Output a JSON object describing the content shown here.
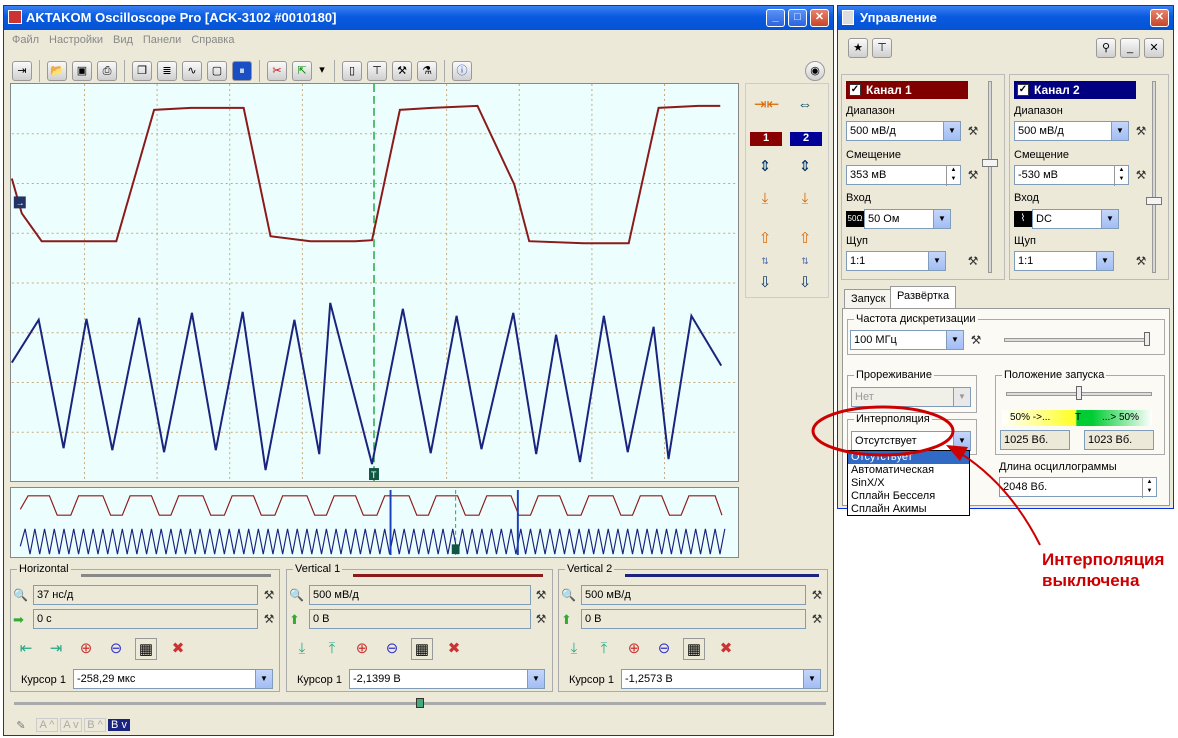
{
  "main_window": {
    "title": "AKTAKOM Oscilloscope Pro [ACK-3102 #0010180]",
    "menu": [
      "Файл",
      "Настройки",
      "Вид",
      "Панели",
      "Справка"
    ]
  },
  "channel_markers": [
    "1",
    "2"
  ],
  "scope_markers": {
    "trigger": "T"
  },
  "bottom": {
    "horizontal": {
      "title": "Horizontal",
      "scale": "37 нс/д",
      "offset": "0 с",
      "cursor_label": "Курсор 1",
      "cursor_value": "-258,29 мкс"
    },
    "vertical1": {
      "title": "Vertical 1",
      "scale": "500 мВ/д",
      "offset": "0 В",
      "cursor_label": "Курсор 1",
      "cursor_value": "-2,1399 В"
    },
    "vertical2": {
      "title": "Vertical 2",
      "scale": "500 мВ/д",
      "offset": "0 В",
      "cursor_label": "Курсор 1",
      "cursor_value": "-1,2573 В"
    },
    "status_tabs": [
      "A ^",
      "A v",
      "B ^",
      "B v"
    ]
  },
  "control": {
    "title": "Управление",
    "ch1": {
      "name": "Канал 1",
      "range_label": "Диапазон",
      "range": "500 мВ/д",
      "offset_label": "Смещение",
      "offset": "353 мВ",
      "input_label": "Вход",
      "input": "50 Ом",
      "input_icon": "50Ω",
      "probe_label": "Щуп",
      "probe": "1:1"
    },
    "ch2": {
      "name": "Канал 2",
      "range_label": "Диапазон",
      "range": "500 мВ/д",
      "offset_label": "Смещение",
      "offset": "-530 мВ",
      "input_label": "Вход",
      "input": "DC",
      "probe_label": "Щуп",
      "probe": "1:1"
    },
    "tabs": [
      "Запуск",
      "Развёртка"
    ],
    "sample_rate_label": "Частота дискретизации",
    "sample_rate": "100 МГц",
    "decimation_label": "Прореживание",
    "decimation": "Нет",
    "interp_label": "Интерполяция",
    "interp": "Отсутствует",
    "interp_options": [
      "Отсутствует",
      "Автоматическая",
      "SinX/X",
      "Сплайн Бесселя",
      "Сплайн Акимы"
    ],
    "trigger_pos_label": "Положение запуска",
    "pre_label": "50% ->...",
    "post_label": "...> 50%",
    "trigger_mark": "T",
    "pre_count": "1025 Вб.",
    "post_count": "1023 Вб.",
    "length_label": "Длина осциллограммы",
    "length": "2048 Вб."
  },
  "annotation": {
    "text_line1": "Интерполяция",
    "text_line2": "выключена",
    "color": "#cc0000"
  },
  "colors": {
    "ch1": "#8b1a1a",
    "ch2": "#1a237e",
    "ch1_header": "#800000",
    "ch2_header": "#000080"
  }
}
